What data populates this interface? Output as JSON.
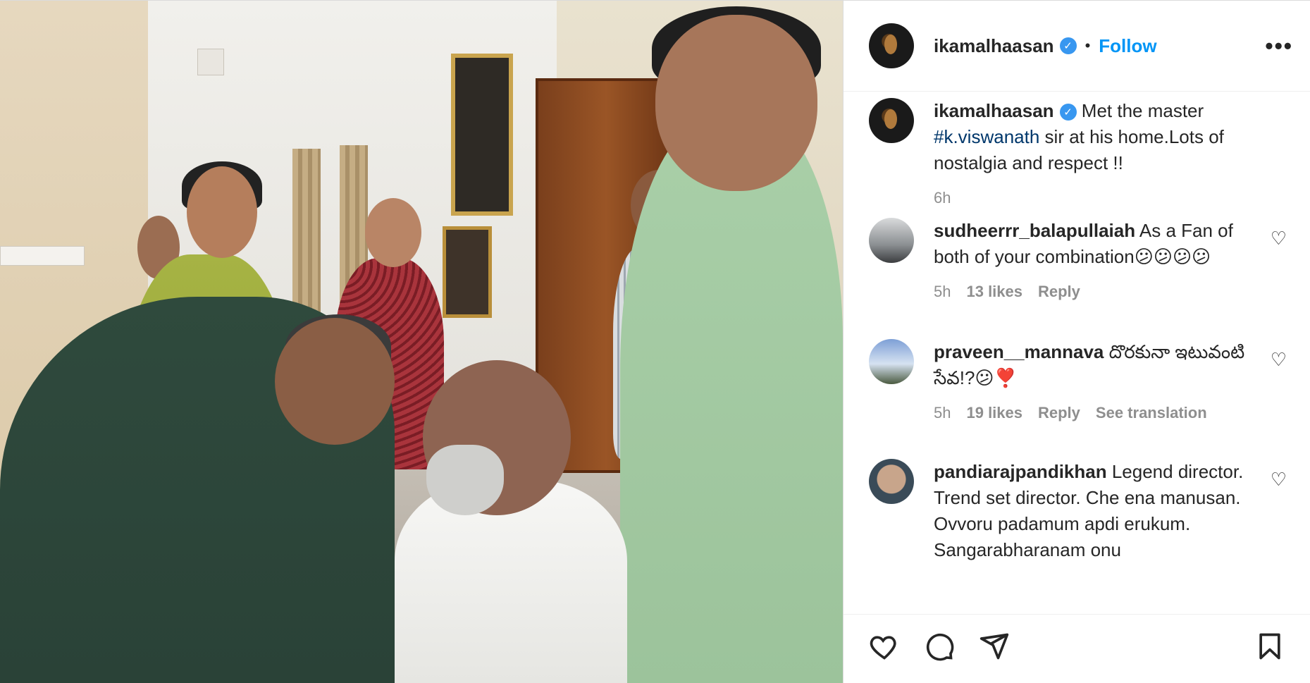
{
  "header": {
    "username": "ikamalhaasan",
    "verified_badge": "✓",
    "separator": "•",
    "follow_label": "Follow",
    "more_label": "•••"
  },
  "caption": {
    "username": "ikamalhaasan",
    "text_before": " Met the master ",
    "hashtag": "#k.viswanath",
    "text_after": " sir at his home.Lots of nostalgia and respect !!",
    "time": "6h"
  },
  "comments": [
    {
      "username": "sudheerrr_balapullaiah",
      "text": " As a Fan of both of your combination😕😕😕😕",
      "time": "5h",
      "likes": "13 likes",
      "reply": "Reply",
      "translation": ""
    },
    {
      "username": "praveen__mannava",
      "text": " దొరకునా ఇటువంటి సేవ!?😕❣️",
      "time": "5h",
      "likes": "19 likes",
      "reply": "Reply",
      "translation": "See translation"
    },
    {
      "username": "pandiarajpandikhan",
      "text": " Legend director. Trend set director. Che ena manusan. Ovvoru padamum apdi erukum. Sangarabharanam onu",
      "time": "",
      "likes": "",
      "reply": "",
      "translation": ""
    }
  ],
  "icons": {
    "like": "heart-icon",
    "comment": "comment-icon",
    "share": "share-icon",
    "save": "bookmark-icon",
    "comment_like": "heart-icon"
  },
  "colors": {
    "accent": "#0095f6",
    "verified": "#3897f0",
    "hashtag": "#00376b",
    "muted": "#8e8e8e"
  }
}
